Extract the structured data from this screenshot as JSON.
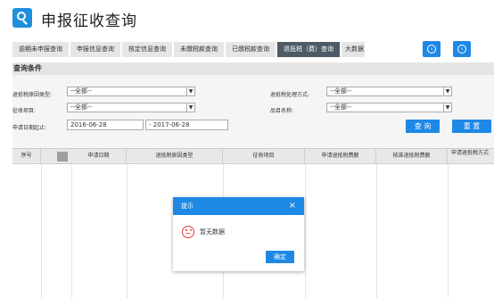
{
  "header": {
    "title": "申报征收查询"
  },
  "tabs": [
    {
      "label": "逾期未申报查询"
    },
    {
      "label": "申报信息查询"
    },
    {
      "label": "核定信息查询"
    },
    {
      "label": "未缴税款查询"
    },
    {
      "label": "已缴税款查询"
    },
    {
      "label": "退抵税（费）查询",
      "active": true
    },
    {
      "label": "大数据"
    }
  ],
  "query": {
    "title": "查询条件",
    "refund_type_label": "退抵税原因类型:",
    "refund_type_value": "--全部--",
    "process_method_label": "退抵税处理方式:",
    "process_method_value": "--全部--",
    "levy_item_label": "征收项目:",
    "levy_item_value": "--全部--",
    "item_name_label": "品目名称:",
    "item_name_value": "--全部--",
    "date_label": "申请日期起止:",
    "date_from": "2016-06-28",
    "date_to": "- 2017-06-28",
    "query_button": "查 询",
    "reset_button": "重 置"
  },
  "grid": {
    "columns": [
      "序号",
      "申请日期",
      "退抵税原因类型",
      "征收项目",
      "申请退抵税费额",
      "核准退抵税费额",
      "申请退抵税方式"
    ]
  },
  "modal": {
    "title": "提示",
    "close": "×",
    "message": "暂无数据",
    "ok": "确定"
  },
  "colors": {
    "accent": "#1e88e5",
    "active_tab": "#4e5b66",
    "error": "#e53935"
  },
  "icons": [
    "search-icon",
    "chevron-left-icon",
    "chevron-right-icon",
    "sad-face-icon"
  ]
}
